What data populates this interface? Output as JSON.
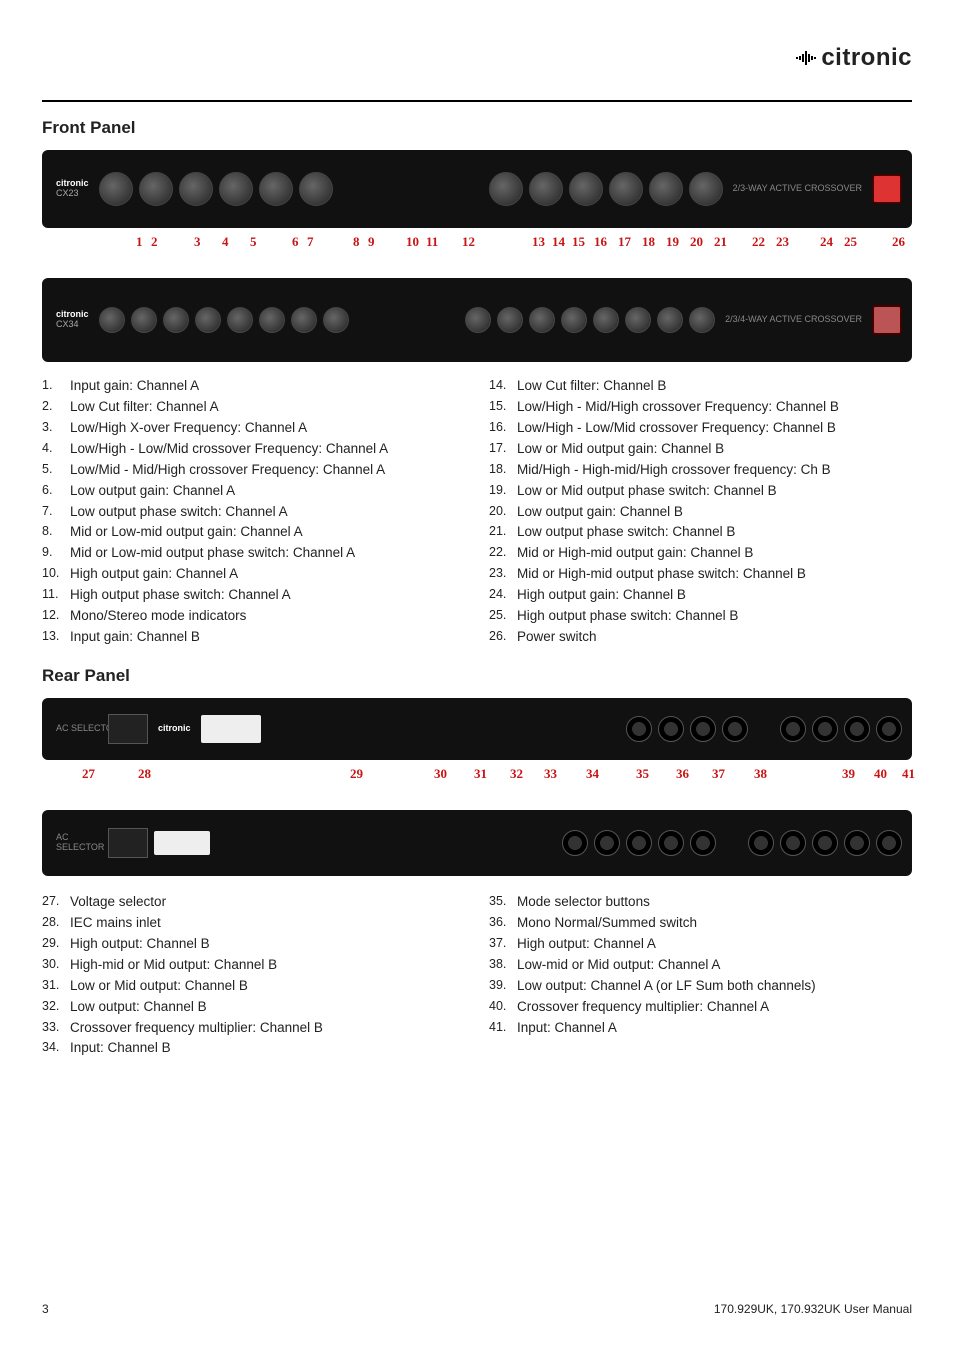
{
  "brand": "citronic",
  "section_front": "Front Panel",
  "section_rear": "Rear Panel",
  "dev_brand_small": "citronic",
  "dev_model_1": "CX23",
  "dev_model_2": "CX34",
  "dev_right_text": "2/3-WAY\nACTIVE\nCROSSOVER",
  "dev_right_text2": "2/3/4-WAY\nACTIVE\nCROSSOVER",
  "front_callouts_a": [
    "1",
    "2",
    "3",
    "4",
    "5",
    "6",
    "7",
    "8",
    "9",
    "10",
    "11",
    "12",
    "13",
    "14",
    "15",
    "16",
    "17",
    "18",
    "19",
    "20",
    "21",
    "22",
    "23",
    "24",
    "25",
    "26"
  ],
  "rear_callouts": [
    "27",
    "28",
    "29",
    "30",
    "31",
    "32",
    "33",
    "34",
    "35",
    "36",
    "37",
    "38",
    "39",
    "40",
    "41"
  ],
  "front_list_left": [
    {
      "n": "1.",
      "t": "Input gain: Channel A"
    },
    {
      "n": "2.",
      "t": "Low Cut filter: Channel A"
    },
    {
      "n": "3.",
      "t": "Low/High X-over Frequency: Channel A"
    },
    {
      "n": "4.",
      "t": "Low/High - Low/Mid crossover Frequency: Channel A"
    },
    {
      "n": "5.",
      "t": "Low/Mid - Mid/High crossover Frequency: Channel A"
    },
    {
      "n": "6.",
      "t": "Low output gain: Channel A"
    },
    {
      "n": "7.",
      "t": "Low output phase switch: Channel A"
    },
    {
      "n": "8.",
      "t": "Mid or Low-mid output gain: Channel A"
    },
    {
      "n": "9.",
      "t": "Mid or Low-mid output phase switch: Channel A"
    },
    {
      "n": "10.",
      "t": "High output gain: Channel A"
    },
    {
      "n": "11.",
      "t": "High output phase switch: Channel A"
    },
    {
      "n": "12.",
      "t": "Mono/Stereo mode indicators"
    },
    {
      "n": "13.",
      "t": "Input gain: Channel B"
    }
  ],
  "front_list_right": [
    {
      "n": "14.",
      "t": "Low Cut filter: Channel B"
    },
    {
      "n": "15.",
      "t": "Low/High - Mid/High crossover Frequency: Channel B"
    },
    {
      "n": "16.",
      "t": "Low/High - Low/Mid crossover Frequency: Channel B"
    },
    {
      "n": "17.",
      "t": "Low or Mid output gain: Channel B"
    },
    {
      "n": "18.",
      "t": "Mid/High - High-mid/High crossover frequency: Ch B"
    },
    {
      "n": "19.",
      "t": "Low or Mid output phase switch: Channel B"
    },
    {
      "n": "20.",
      "t": "Low output gain: Channel B"
    },
    {
      "n": "21.",
      "t": "Low output phase switch: Channel B"
    },
    {
      "n": "22.",
      "t": "Mid or High-mid output gain: Channel B"
    },
    {
      "n": "23.",
      "t": "Mid or High-mid output phase switch: Channel B"
    },
    {
      "n": "24.",
      "t": "High output gain: Channel B"
    },
    {
      "n": "25.",
      "t": "High output phase switch: Channel B"
    },
    {
      "n": "26.",
      "t": "Power switch"
    }
  ],
  "rear_list_left": [
    {
      "n": "27.",
      "t": "Voltage selector"
    },
    {
      "n": "28.",
      "t": "IEC mains inlet"
    },
    {
      "n": "29.",
      "t": "High output: Channel B"
    },
    {
      "n": "30.",
      "t": "High-mid or Mid output: Channel B"
    },
    {
      "n": "31.",
      "t": "Low or Mid output: Channel B"
    },
    {
      "n": "32.",
      "t": "Low output: Channel B"
    },
    {
      "n": "33.",
      "t": "Crossover frequency multiplier: Channel B"
    },
    {
      "n": "34.",
      "t": "Input: Channel B"
    }
  ],
  "rear_list_right": [
    {
      "n": "35.",
      "t": "Mode selector buttons"
    },
    {
      "n": "36.",
      "t": "Mono Normal/Summed switch"
    },
    {
      "n": "37.",
      "t": "High output: Channel A"
    },
    {
      "n": "38.",
      "t": "Low-mid or Mid output: Channel A"
    },
    {
      "n": "39.",
      "t": "Low output: Channel A (or LF Sum both channels)"
    },
    {
      "n": "40.",
      "t": "Crossover frequency multiplier: Channel A"
    },
    {
      "n": "41.",
      "t": "Input: Channel A"
    }
  ],
  "footer_page": "3",
  "footer_doc": "170.929UK, 170.932UK User Manual"
}
